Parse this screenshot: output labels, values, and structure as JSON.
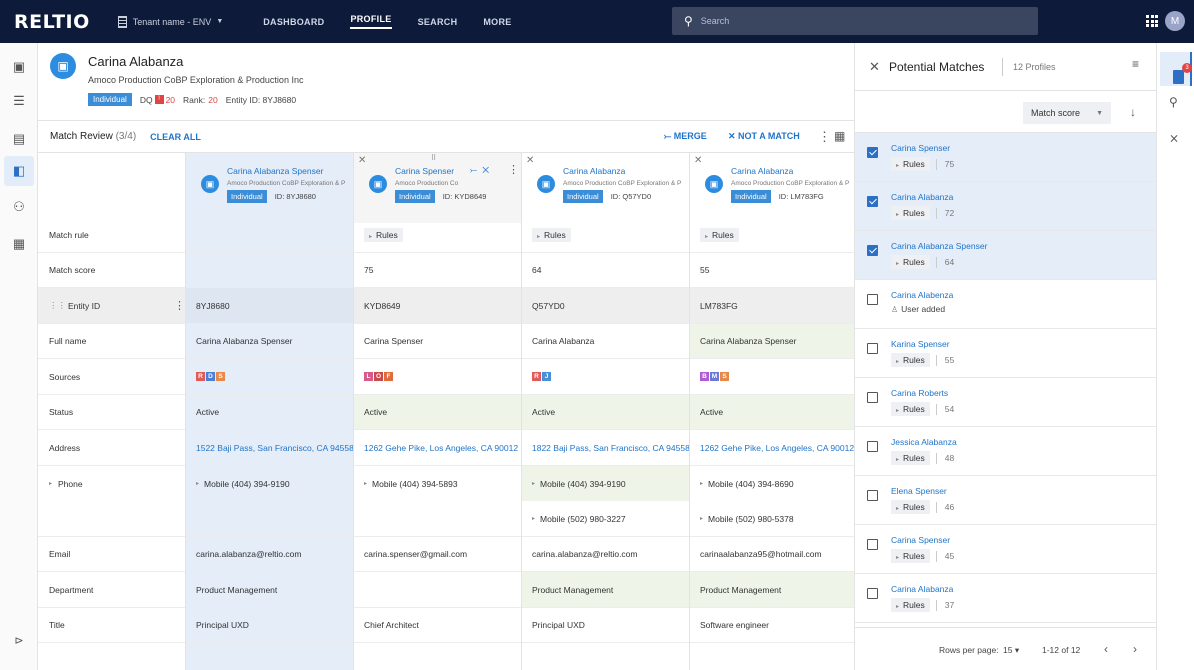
{
  "topbar": {
    "logo": "RELTIO",
    "tenant": "Tenant name - ENV",
    "nav": [
      "DASHBOARD",
      "PROFILE",
      "SEARCH",
      "MORE"
    ],
    "active_nav": "PROFILE",
    "search_placeholder": "Search",
    "avatar_initial": "M"
  },
  "profile": {
    "name": "Carina Alabanza",
    "org": "Amoco Production CoBP Exploration & Production Inc",
    "type_badge": "Individual",
    "dq_label": "DQ",
    "dq_value": "20",
    "rank_label": "Rank:",
    "rank_value": "20",
    "entity_id": "Entity ID: 8YJ8680"
  },
  "match_review": {
    "title": "Match Review",
    "count": "(3/4)",
    "clear_all": "CLEAR ALL",
    "merge": "MERGE",
    "not_a_match": "NOT A MATCH"
  },
  "columns": [
    {
      "name": "Carina Alabanza Spenser",
      "org": "Amoco Production CoBP Exploration & Pr",
      "badge": "Individual",
      "id": "ID: 8YJ8680"
    },
    {
      "name": "Carina Spenser",
      "org": "Amoco Production Co",
      "badge": "Individual",
      "id": "ID: KYD8649"
    },
    {
      "name": "Carina Alabanza",
      "org": "Amoco Production CoBP Exploration & Pr",
      "badge": "Individual",
      "id": "ID: Q57YD0"
    },
    {
      "name": "Carina Alabanza",
      "org": "Amoco Production CoBP Exploration & Pr",
      "badge": "Individual",
      "id": "ID: LM783FG"
    }
  ],
  "rows": {
    "match_rule": {
      "label": "Match rule",
      "values": [
        "",
        "Rules",
        "Rules",
        "Rules"
      ]
    },
    "match_score": {
      "label": "Match score",
      "values": [
        "",
        "75",
        "64",
        "55"
      ]
    },
    "entity_id": {
      "label": "Entity ID",
      "values": [
        "8YJ8680",
        "KYD8649",
        "Q57YD0",
        "LM783FG"
      ]
    },
    "full_name": {
      "label": "Full name",
      "values": [
        "Carina Alabanza Spenser",
        "Carina Spenser",
        "Carina Alabanza",
        "Carina Alabanza Spenser"
      ]
    },
    "sources": {
      "label": "Sources",
      "values": [
        [
          "R",
          "D",
          "S"
        ],
        [
          "L",
          "O",
          "F"
        ],
        [
          "R",
          "J"
        ],
        [
          "B",
          "M",
          "S"
        ]
      ]
    },
    "status": {
      "label": "Status",
      "values": [
        "Active",
        "Active",
        "Active",
        "Active"
      ]
    },
    "address": {
      "label": "Address",
      "values": [
        "1522 Baji Pass, San Francisco, CA 94558",
        "1262 Gehe Pike, Los Angeles, CA 90012",
        "1822 Baji Pass, San Francisco, CA 94558",
        "1262 Gehe Pike, Los Angeles, CA 90012"
      ]
    },
    "phone": {
      "label": "Phone",
      "values": [
        "Mobile (404) 394-9190",
        "Mobile (404) 394-5893",
        "Mobile (404) 394-9190",
        "Mobile (404) 394-8690"
      ]
    },
    "phone2": {
      "values": [
        "",
        "",
        "Mobile (502) 980-3227",
        "Mobile (502) 980-5378"
      ]
    },
    "email": {
      "label": "Email",
      "values": [
        "carina.alabanza@reltio.com",
        "carina.spenser@gmail.com",
        "carina.alabanza@reltio.com",
        "carinaalabanza95@hotmail.com"
      ]
    },
    "department": {
      "label": "Department",
      "values": [
        "Product Management",
        "",
        "Product Management",
        "Product Management"
      ]
    },
    "title": {
      "label": "Title",
      "values": [
        "Principal UXD",
        "Chief Architect",
        "Principal UXD",
        "Software engineer"
      ]
    }
  },
  "source_colors": {
    "R": "#e05a5a",
    "D": "#4a7fd6",
    "S": "#e8894a",
    "L": "#d65a8a",
    "O": "#c84a4a",
    "F": "#e06a3a",
    "J": "#4a90d6",
    "B": "#b05ad6",
    "M": "#6a7ad6"
  },
  "potential_matches": {
    "title": "Potential Matches",
    "count": "12 Profiles",
    "sort_label": "Match score",
    "items": [
      {
        "name": "Carina Spenser",
        "rules": "Rules",
        "score": "75",
        "checked": true
      },
      {
        "name": "Carina Alabanza",
        "rules": "Rules",
        "score": "72",
        "checked": true
      },
      {
        "name": "Carina Alabanza Spenser",
        "rules": "Rules",
        "score": "64",
        "checked": true
      },
      {
        "name": "Carina Alabenza",
        "user_added": "User added",
        "checked": false
      },
      {
        "name": "Karina Spenser",
        "rules": "Rules",
        "score": "55",
        "checked": false
      },
      {
        "name": "Carina Roberts",
        "rules": "Rules",
        "score": "54",
        "checked": false
      },
      {
        "name": "Jessica Alabanza",
        "rules": "Rules",
        "score": "48",
        "checked": false
      },
      {
        "name": "Elena Spenser",
        "rules": "Rules",
        "score": "46",
        "checked": false
      },
      {
        "name": "Carina Spenser",
        "rules": "Rules",
        "score": "45",
        "checked": false
      },
      {
        "name": "Carina Alabanza",
        "rules": "Rules",
        "score": "37",
        "checked": false
      }
    ],
    "rows_per_page_label": "Rows per page:",
    "rows_per_page_value": "15",
    "range": "1-12 of 12"
  },
  "right_rail": {
    "badge": "3"
  }
}
